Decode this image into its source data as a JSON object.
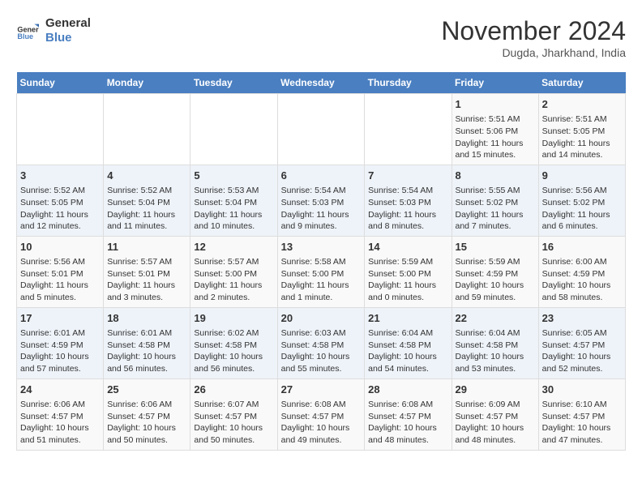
{
  "logo": {
    "line1": "General",
    "line2": "Blue"
  },
  "title": "November 2024",
  "location": "Dugda, Jharkhand, India",
  "weekdays": [
    "Sunday",
    "Monday",
    "Tuesday",
    "Wednesday",
    "Thursday",
    "Friday",
    "Saturday"
  ],
  "rows": [
    [
      {
        "day": "",
        "info": ""
      },
      {
        "day": "",
        "info": ""
      },
      {
        "day": "",
        "info": ""
      },
      {
        "day": "",
        "info": ""
      },
      {
        "day": "",
        "info": ""
      },
      {
        "day": "1",
        "info": "Sunrise: 5:51 AM\nSunset: 5:06 PM\nDaylight: 11 hours\nand 15 minutes."
      },
      {
        "day": "2",
        "info": "Sunrise: 5:51 AM\nSunset: 5:05 PM\nDaylight: 11 hours\nand 14 minutes."
      }
    ],
    [
      {
        "day": "3",
        "info": "Sunrise: 5:52 AM\nSunset: 5:05 PM\nDaylight: 11 hours\nand 12 minutes."
      },
      {
        "day": "4",
        "info": "Sunrise: 5:52 AM\nSunset: 5:04 PM\nDaylight: 11 hours\nand 11 minutes."
      },
      {
        "day": "5",
        "info": "Sunrise: 5:53 AM\nSunset: 5:04 PM\nDaylight: 11 hours\nand 10 minutes."
      },
      {
        "day": "6",
        "info": "Sunrise: 5:54 AM\nSunset: 5:03 PM\nDaylight: 11 hours\nand 9 minutes."
      },
      {
        "day": "7",
        "info": "Sunrise: 5:54 AM\nSunset: 5:03 PM\nDaylight: 11 hours\nand 8 minutes."
      },
      {
        "day": "8",
        "info": "Sunrise: 5:55 AM\nSunset: 5:02 PM\nDaylight: 11 hours\nand 7 minutes."
      },
      {
        "day": "9",
        "info": "Sunrise: 5:56 AM\nSunset: 5:02 PM\nDaylight: 11 hours\nand 6 minutes."
      }
    ],
    [
      {
        "day": "10",
        "info": "Sunrise: 5:56 AM\nSunset: 5:01 PM\nDaylight: 11 hours\nand 5 minutes."
      },
      {
        "day": "11",
        "info": "Sunrise: 5:57 AM\nSunset: 5:01 PM\nDaylight: 11 hours\nand 3 minutes."
      },
      {
        "day": "12",
        "info": "Sunrise: 5:57 AM\nSunset: 5:00 PM\nDaylight: 11 hours\nand 2 minutes."
      },
      {
        "day": "13",
        "info": "Sunrise: 5:58 AM\nSunset: 5:00 PM\nDaylight: 11 hours\nand 1 minute."
      },
      {
        "day": "14",
        "info": "Sunrise: 5:59 AM\nSunset: 5:00 PM\nDaylight: 11 hours\nand 0 minutes."
      },
      {
        "day": "15",
        "info": "Sunrise: 5:59 AM\nSunset: 4:59 PM\nDaylight: 10 hours\nand 59 minutes."
      },
      {
        "day": "16",
        "info": "Sunrise: 6:00 AM\nSunset: 4:59 PM\nDaylight: 10 hours\nand 58 minutes."
      }
    ],
    [
      {
        "day": "17",
        "info": "Sunrise: 6:01 AM\nSunset: 4:59 PM\nDaylight: 10 hours\nand 57 minutes."
      },
      {
        "day": "18",
        "info": "Sunrise: 6:01 AM\nSunset: 4:58 PM\nDaylight: 10 hours\nand 56 minutes."
      },
      {
        "day": "19",
        "info": "Sunrise: 6:02 AM\nSunset: 4:58 PM\nDaylight: 10 hours\nand 56 minutes."
      },
      {
        "day": "20",
        "info": "Sunrise: 6:03 AM\nSunset: 4:58 PM\nDaylight: 10 hours\nand 55 minutes."
      },
      {
        "day": "21",
        "info": "Sunrise: 6:04 AM\nSunset: 4:58 PM\nDaylight: 10 hours\nand 54 minutes."
      },
      {
        "day": "22",
        "info": "Sunrise: 6:04 AM\nSunset: 4:58 PM\nDaylight: 10 hours\nand 53 minutes."
      },
      {
        "day": "23",
        "info": "Sunrise: 6:05 AM\nSunset: 4:57 PM\nDaylight: 10 hours\nand 52 minutes."
      }
    ],
    [
      {
        "day": "24",
        "info": "Sunrise: 6:06 AM\nSunset: 4:57 PM\nDaylight: 10 hours\nand 51 minutes."
      },
      {
        "day": "25",
        "info": "Sunrise: 6:06 AM\nSunset: 4:57 PM\nDaylight: 10 hours\nand 50 minutes."
      },
      {
        "day": "26",
        "info": "Sunrise: 6:07 AM\nSunset: 4:57 PM\nDaylight: 10 hours\nand 50 minutes."
      },
      {
        "day": "27",
        "info": "Sunrise: 6:08 AM\nSunset: 4:57 PM\nDaylight: 10 hours\nand 49 minutes."
      },
      {
        "day": "28",
        "info": "Sunrise: 6:08 AM\nSunset: 4:57 PM\nDaylight: 10 hours\nand 48 minutes."
      },
      {
        "day": "29",
        "info": "Sunrise: 6:09 AM\nSunset: 4:57 PM\nDaylight: 10 hours\nand 48 minutes."
      },
      {
        "day": "30",
        "info": "Sunrise: 6:10 AM\nSunset: 4:57 PM\nDaylight: 10 hours\nand 47 minutes."
      }
    ]
  ]
}
